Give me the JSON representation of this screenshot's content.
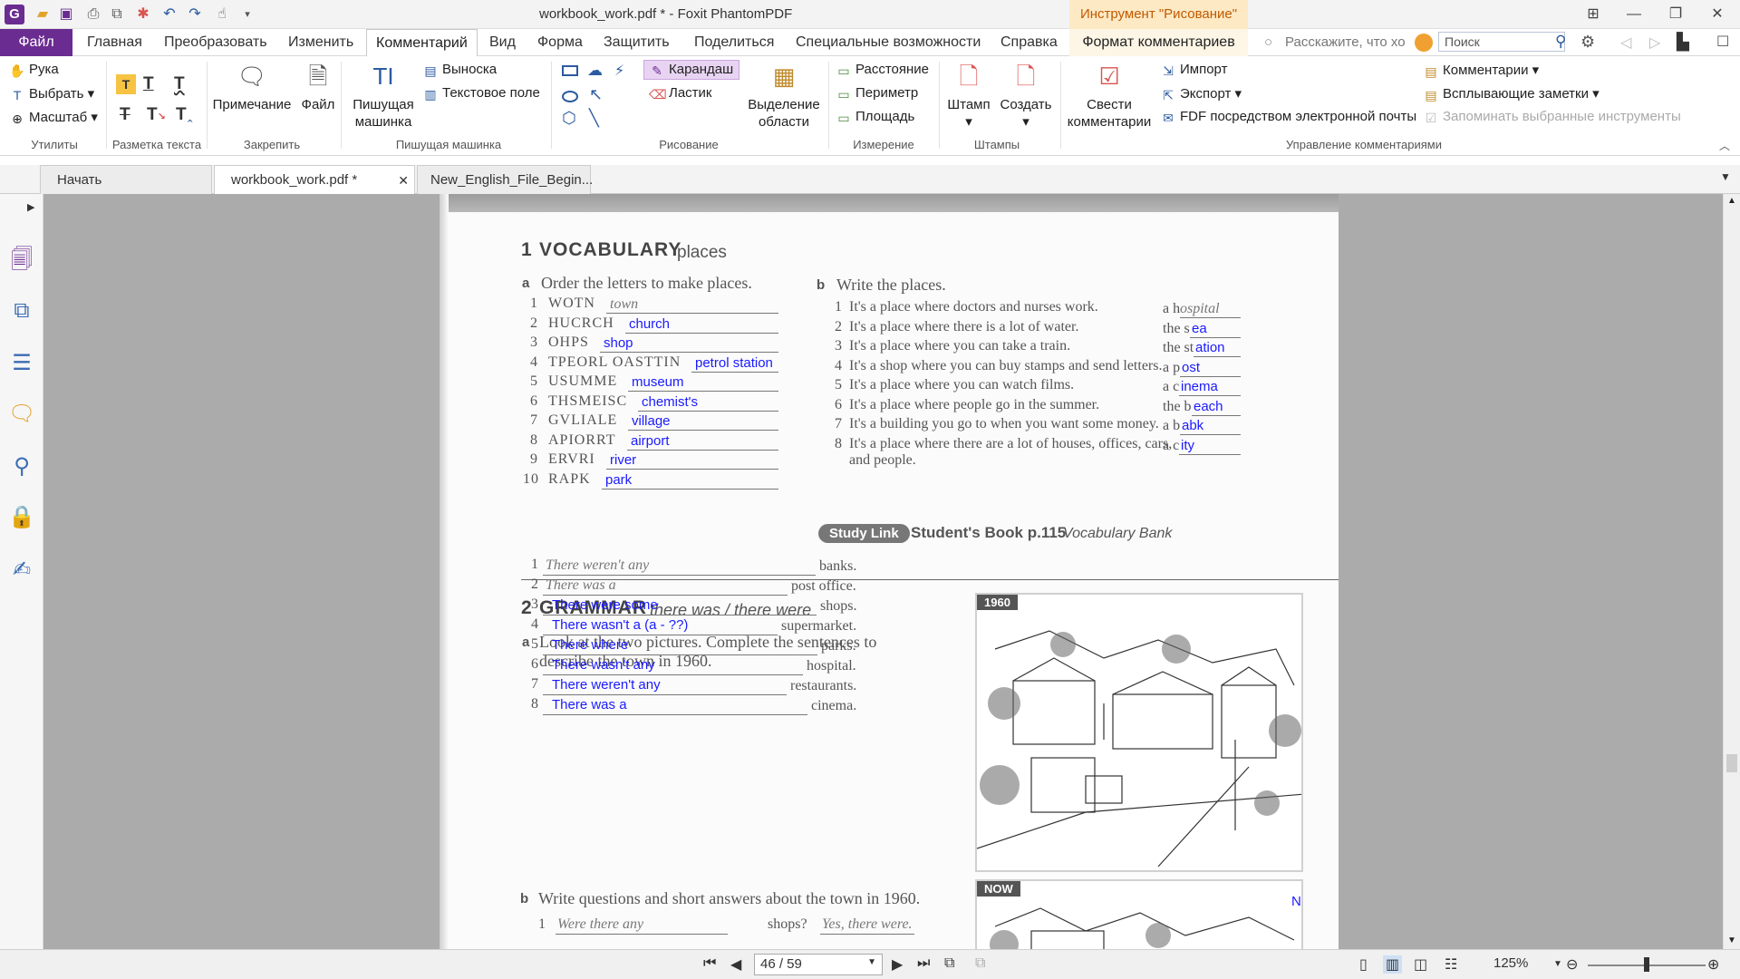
{
  "window": {
    "title": "workbook_work.pdf * - Foxit PhantomPDF",
    "context_tool": "Инструмент \"Рисование\""
  },
  "menu": {
    "file": "Файл",
    "items": [
      "Главная",
      "Преобразовать",
      "Изменить",
      "Комментарий",
      "Вид",
      "Форма",
      "Защитить",
      "Поделиться",
      "Специальные возможности",
      "Справка"
    ],
    "context": "Формат комментариев",
    "tell_me": "Расскажите, что хо",
    "search_placeholder": "Поиск"
  },
  "ribbon": {
    "hand": "Рука",
    "select": "Выбрать",
    "zoom": "Масштаб",
    "group_utilities": "Утилиты",
    "group_text_markup": "Разметка текста",
    "note": "Примечание",
    "file": "Файл",
    "group_pin": "Закрепить",
    "typewriter": "Пишущая машинка",
    "callout": "Выноска",
    "textbox": "Текстовое поле",
    "group_typewriter": "Пишущая машинка",
    "pencil": "Карандаш",
    "eraser": "Ластик",
    "area_highlight": "Выделение области",
    "group_drawing": "Рисование",
    "distance": "Расстояние",
    "perimeter": "Периметр",
    "area": "Площадь",
    "group_measure": "Измерение",
    "stamp": "Штамп",
    "create": "Создать",
    "group_stamps": "Штампы",
    "summarize": "Свести комментарии",
    "import": "Импорт",
    "export": "Экспорт",
    "fdf_email": "FDF посредством электронной почты",
    "comments": "Комментарии",
    "popup_notes": "Всплывающие заметки",
    "remember_tools": "Запоминать выбранные инструменты",
    "group_manage": "Управление комментариями"
  },
  "tabs": [
    "Начать",
    "workbook_work.pdf *",
    "New_English_File_Begin..."
  ],
  "page": {
    "vocab": {
      "num": "1",
      "title": "VOCABULARY",
      "subtitle": "places",
      "a_label": "a",
      "a_instr": "Order the letters to make places.",
      "a_items": [
        {
          "n": "1",
          "word": "WOTN",
          "ans": "town",
          "printed": true
        },
        {
          "n": "2",
          "word": "HUCRCH",
          "ans": "church"
        },
        {
          "n": "3",
          "word": "OHPS",
          "ans": "shop"
        },
        {
          "n": "4",
          "word": "TPEORL OASTTIN",
          "ans": "petrol station"
        },
        {
          "n": "5",
          "word": "USUMME",
          "ans": "museum"
        },
        {
          "n": "6",
          "word": "THSMEISC",
          "ans": "chemist's"
        },
        {
          "n": "7",
          "word": "GVLIALE",
          "ans": "village"
        },
        {
          "n": "8",
          "word": "APIORRT",
          "ans": "airport"
        },
        {
          "n": "9",
          "word": "ERVRI",
          "ans": "river"
        },
        {
          "n": "10",
          "word": "RAPK",
          "ans": "park"
        }
      ],
      "b_label": "b",
      "b_instr": "Write the places.",
      "b_items": [
        {
          "n": "1",
          "text": "It's a place where doctors and nurses work.",
          "pre": "a h",
          "ans": "ospital",
          "printed": true
        },
        {
          "n": "2",
          "text": "It's a place where there is a lot of water.",
          "pre": "the s",
          "ans": "ea"
        },
        {
          "n": "3",
          "text": "It's a place where you can take a train.",
          "pre": "the st",
          "ans": "ation"
        },
        {
          "n": "4",
          "text": "It's a shop where you can buy stamps and send letters.",
          "pre": "a p",
          "ans": "ost"
        },
        {
          "n": "5",
          "text": "It's a place where you can watch films.",
          "pre": "a c",
          "ans": "inema"
        },
        {
          "n": "6",
          "text": "It's a place where people go in the summer.",
          "pre": "the b",
          "ans": "each"
        },
        {
          "n": "7",
          "text": "It's a building you go to when you want some money.",
          "pre": "a b",
          "ans": "abk"
        },
        {
          "n": "8",
          "text": "It's a place where there are a lot of houses, offices, cars,",
          "text2": "and people.",
          "pre": "a c",
          "ans": "ity"
        }
      ],
      "study_link": "Study Link",
      "study_book": "Student's Book p.115",
      "study_bank": "Vocabulary Bank"
    },
    "grammar": {
      "num": "2",
      "title": "GRAMMAR",
      "subtitle": "there was / there were",
      "a_label": "a",
      "a_instr1": "Look at the two pictures. Complete the sentences to",
      "a_instr2": "describe the town in 1960.",
      "a_items": [
        {
          "n": "1",
          "ans": "There weren't any",
          "end": "banks.",
          "printed": true
        },
        {
          "n": "2",
          "ans": "There was a",
          "end": "post office.",
          "printed": true
        },
        {
          "n": "3",
          "ans": "There were some",
          "end": "shops."
        },
        {
          "n": "4",
          "ans": "There wasn't a (a - ??)",
          "end": "supermarket."
        },
        {
          "n": "5",
          "ans": "There where",
          "end": "parks."
        },
        {
          "n": "6",
          "ans": "There wasn't any",
          "end": "hospital."
        },
        {
          "n": "7",
          "ans": "There weren't any",
          "end": "restaurants."
        },
        {
          "n": "8",
          "ans": "There was a",
          "end": "cinema."
        }
      ],
      "b_label": "b",
      "b_instr": "Write questions and short answers about the town in 1960.",
      "b1_q": "Were there any",
      "b1_end": "shops?",
      "b1_a": "Yes, there were.",
      "pic1": "1960",
      "pic2": "NOW",
      "pic2_mark": "N"
    }
  },
  "status": {
    "page": "46 / 59",
    "zoom": "125%"
  },
  "colors": {
    "accent": "#6a2c91",
    "answer": "#1a1aff",
    "context_tab": "#fde9c4"
  }
}
